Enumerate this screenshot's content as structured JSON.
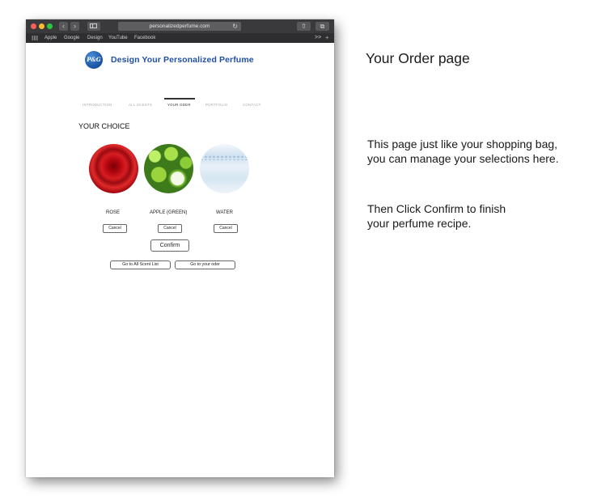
{
  "browser": {
    "url": "personalizedperfume.com",
    "bookmarks": [
      "Apple",
      "Google",
      "Design",
      "YouTube",
      "Facebook"
    ],
    "icons": {
      "back": "chevron-left-icon",
      "forward": "chevron-right-icon",
      "reload": "reload-icon",
      "share": "share-icon",
      "tabs": "tabs-icon"
    }
  },
  "site": {
    "logo_text": "P&G",
    "title": "Design Your Personalized Perfume",
    "menu": [
      "INTRODUCTION",
      "ALL SCENTS",
      "YOUR ODER",
      "PORTFOLIO",
      "CONTACT"
    ],
    "active_menu": "YOUR ODER",
    "brand_color": "#1f4fa3"
  },
  "order": {
    "heading": "YOUR CHOICE",
    "scents": [
      {
        "name": "ROSE",
        "image": "red-rose",
        "cancel_label": "Cancel"
      },
      {
        "name": "APPLE (GREEN)",
        "image": "green-apples",
        "cancel_label": "Cancel"
      },
      {
        "name": "WATER",
        "image": "water-splash",
        "cancel_label": "Cancel"
      }
    ],
    "confirm_label": "Confirm",
    "go_scents_label": "Go to All Scent List",
    "go_order_label": "Go to your oder"
  },
  "annotation": {
    "title": "Your Order page",
    "p1": [
      "This page just like your shopping bag,",
      "you can manage your selections  here."
    ],
    "p2": [
      "Then Click Confirm to finish",
      "your perfume recipe."
    ]
  }
}
